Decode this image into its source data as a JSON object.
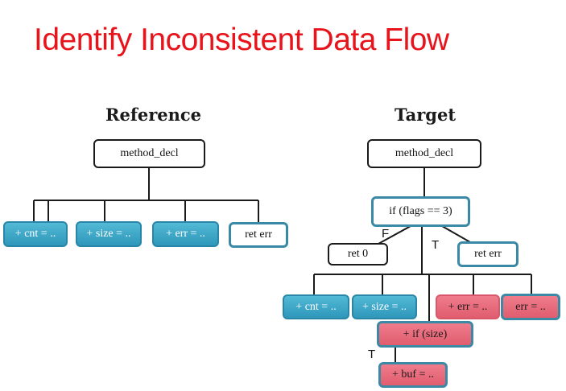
{
  "title": "Identify Inconsistent Data Flow",
  "reference": {
    "heading": "Reference",
    "root": "method_decl",
    "children": [
      "+ cnt = ..",
      "+ size = ..",
      "+ err = ..",
      "ret err"
    ]
  },
  "target": {
    "heading": "Target",
    "root": "method_decl",
    "condition": "if (flags == 3)",
    "false_label": "F",
    "true_label": "T",
    "false_branch": "ret 0",
    "true_branch": "ret err",
    "children": [
      "+ cnt = ..",
      "+ size = ..",
      "+ err = ..",
      "err = .."
    ],
    "nested_condition": "+ if (size)",
    "nested_true_label": "T",
    "nested_body": "+ buf = .."
  },
  "colors": {
    "title": "#e8141c",
    "added_node": "#2f97ba",
    "inconsistent_node": "#e05d6e",
    "outline_highlight": "#3a8aa6"
  }
}
